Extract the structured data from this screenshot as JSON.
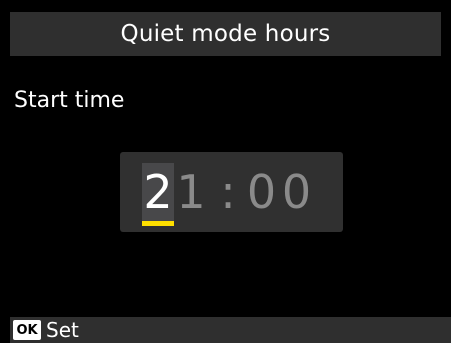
{
  "title": "Quiet mode hours",
  "field_label": "Start time",
  "time": {
    "hour_tens": "2",
    "hour_ones": "1",
    "separator": ":",
    "minute_tens": "0",
    "minute_ones": "0"
  },
  "footer": {
    "ok_key": "OK",
    "ok_action": "Set"
  },
  "colors": {
    "background": "#000000",
    "bar": "#2f2f2f",
    "cursor": "#ffe000",
    "inactive_digit": "#8a8a8a"
  }
}
